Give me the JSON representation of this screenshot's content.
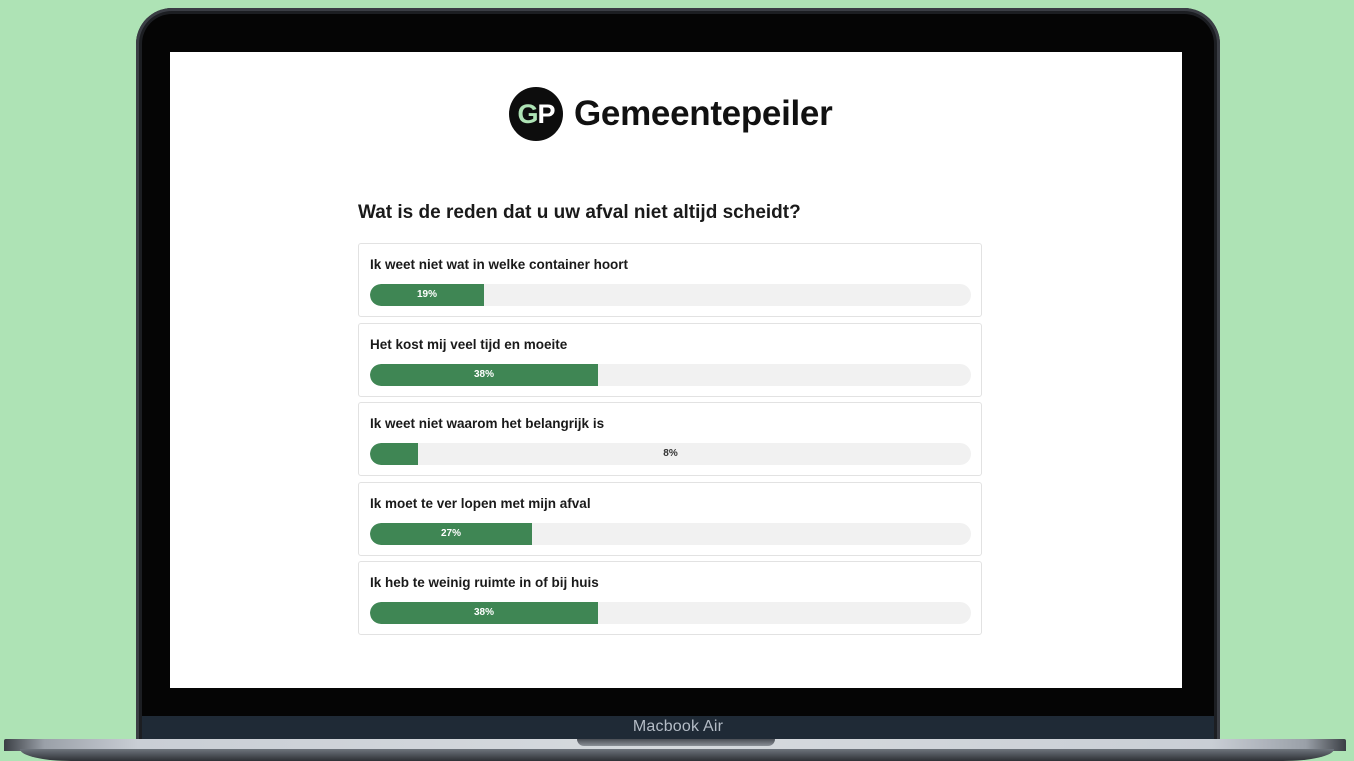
{
  "device": {
    "label": "Macbook Air"
  },
  "brand": {
    "logo_letter_1": "G",
    "logo_letter_2": "P",
    "name": "Gemeentepeiler",
    "logo_accent_color": "#aee3b5"
  },
  "poll": {
    "question": "Wat is de reden dat u uw afval niet altijd scheidt?",
    "bar_color": "#3f8654",
    "track_color": "#f1f1f1",
    "options": [
      {
        "label": "Ik weet niet wat in welke container hoort",
        "percent": 19,
        "percent_label": "19%"
      },
      {
        "label": "Het kost mij veel tijd en moeite",
        "percent": 38,
        "percent_label": "38%"
      },
      {
        "label": "Ik weet niet waarom het belangrijk is",
        "percent": 8,
        "percent_label": "8%"
      },
      {
        "label": "Ik moet te ver lopen met mijn afval",
        "percent": 27,
        "percent_label": "27%"
      },
      {
        "label": "Ik heb te weinig ruimte in of bij huis",
        "percent": 38,
        "percent_label": "38%"
      }
    ]
  }
}
